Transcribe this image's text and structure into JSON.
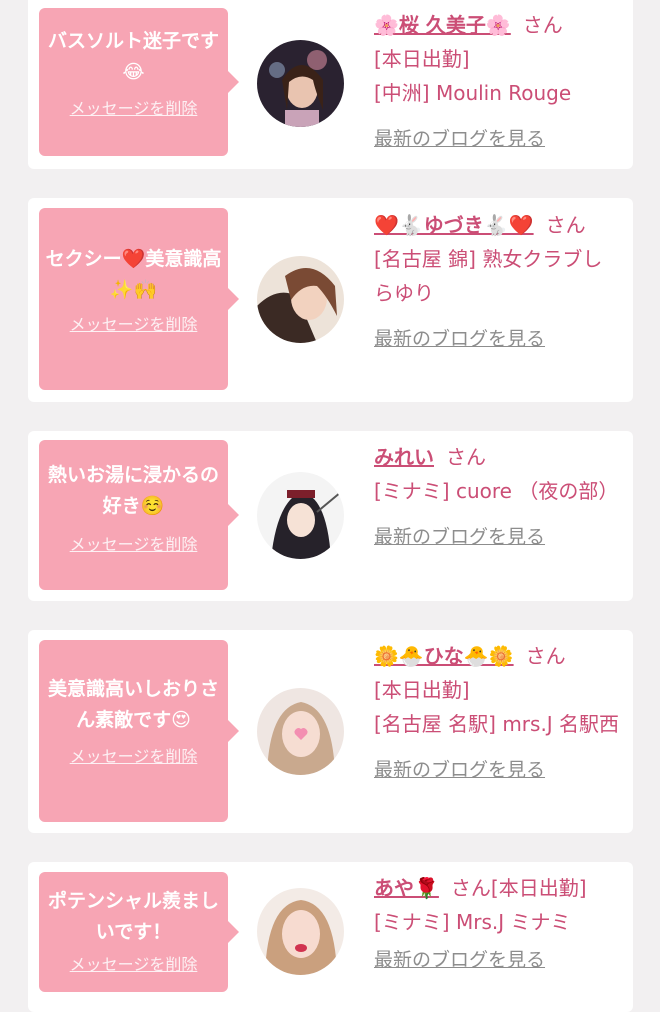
{
  "cards": [
    {
      "message": "バスソルト迷子です😂",
      "delete_label": "メッセージを削除",
      "name": "🌸桜 久美子🌸",
      "honorific": "さん",
      "lines": [
        "[本日出勤]",
        "[中洲] Moulin Rouge"
      ],
      "blog_label": "最新のブログを見る"
    },
    {
      "message": "セクシー❤️美意識高✨🙌",
      "delete_label": "メッセージを削除",
      "name": "❤️🐇ゆづき🐇❤️",
      "honorific": "さん",
      "lines": [
        "[名古屋 錦] 熟女クラブしらゆり"
      ],
      "blog_label": "最新のブログを見る"
    },
    {
      "message": "熱いお湯に浸かるの好き☺️",
      "delete_label": "メッセージを削除",
      "name": "みれい",
      "honorific": "さん",
      "lines": [
        "[ミナミ] cuore （夜の部）"
      ],
      "blog_label": "最新のブログを見る"
    },
    {
      "message": "美意識高いしおりさん素敵です😍",
      "delete_label": "メッセージを削除",
      "name": "🌼🐣ひな🐣🌼",
      "honorific": "さん",
      "lines": [
        "[本日出勤]",
        "[名古屋 名駅] mrs.J 名駅西"
      ],
      "blog_label": "最新のブログを見る"
    },
    {
      "message": "ポテンシャル羨ましいです！",
      "delete_label": "メッセージを削除",
      "name": "あや🌹",
      "honorific": "さん[本日出勤]",
      "lines": [
        "[ミナミ] Mrs.J ミナミ"
      ],
      "blog_label": "最新のブログを見る"
    }
  ],
  "colors": {
    "background": "#f2f0f1",
    "bubble": "#f7a5b4",
    "accent_text": "#cb4e76",
    "link_gray": "#8d8d8d"
  }
}
